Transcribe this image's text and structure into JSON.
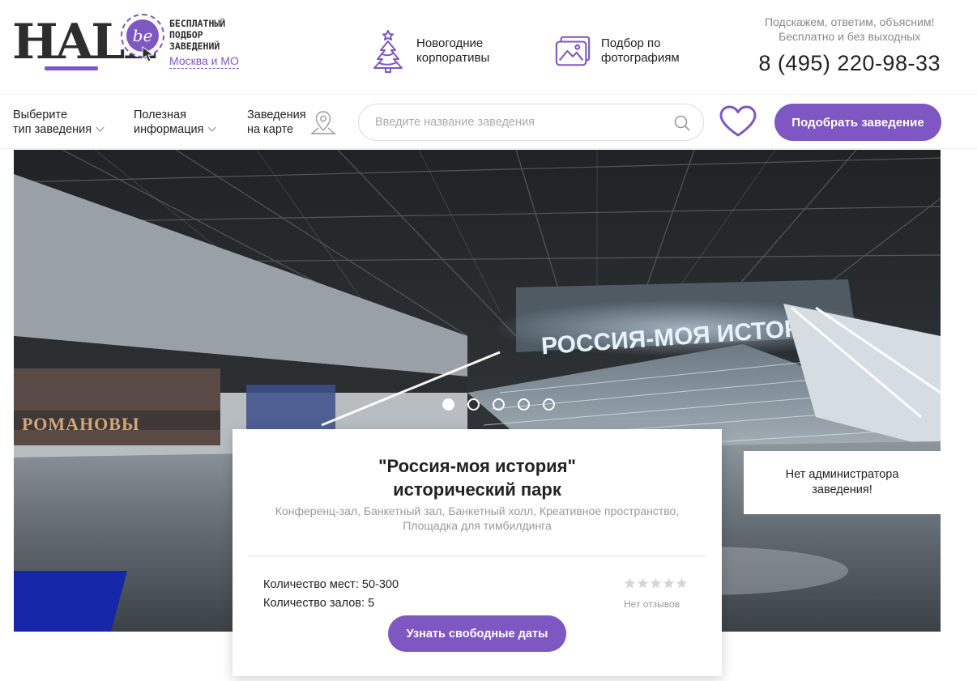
{
  "brand": {
    "logo_word": "HALL",
    "logo_badge": "be",
    "tagline": [
      "БЕСПЛАТНЫЙ",
      "ПОДБОР",
      "ЗАВЕДЕНИЙ"
    ],
    "city": "Москва и МО",
    "accent_color": "#7e57c2"
  },
  "promos": [
    {
      "icon": "christmas-tree-icon",
      "line1": "Новогодние",
      "line2": "корпоративы"
    },
    {
      "icon": "photo-gallery-icon",
      "line1": "Подбор по",
      "line2": "фотографиям"
    }
  ],
  "contact": {
    "line1": "Подскажем, ответим, объясним!",
    "line2": "Бесплатно и без выходных",
    "phone": "8 (495) 220-98-33"
  },
  "nav": {
    "type_line1": "Выберите",
    "type_line2": "тип заведения",
    "info_line1": "Полезная",
    "info_line2": "информация",
    "map_line1": "Заведения",
    "map_line2": "на карте",
    "search_placeholder": "Введите название заведения",
    "cta_label": "Подобрать заведение"
  },
  "hero": {
    "slide_count": 5,
    "active_slide": 1,
    "banner_text": "РОССИЯ-МОЯ ИСТОРИЯ",
    "mural_text": "РОМАНОВЫ",
    "admin_note": "Нет администратора заведения!"
  },
  "venue": {
    "title_line1": "\"Россия-моя история\"",
    "title_line2": "исторический парк",
    "categories": "Конференц-зал, Банкетный зал, Банкетный холл, Креативное пространство, Площадка для тимбилдинга",
    "seats_label": "Количество мест:",
    "seats_value": "50-300",
    "halls_label": "Количество залов:",
    "halls_value": "5",
    "rating_stars": 0,
    "rating_max": 5,
    "reviews_text": "Нет отзывов",
    "cta_label": "Узнать свободные даты"
  }
}
